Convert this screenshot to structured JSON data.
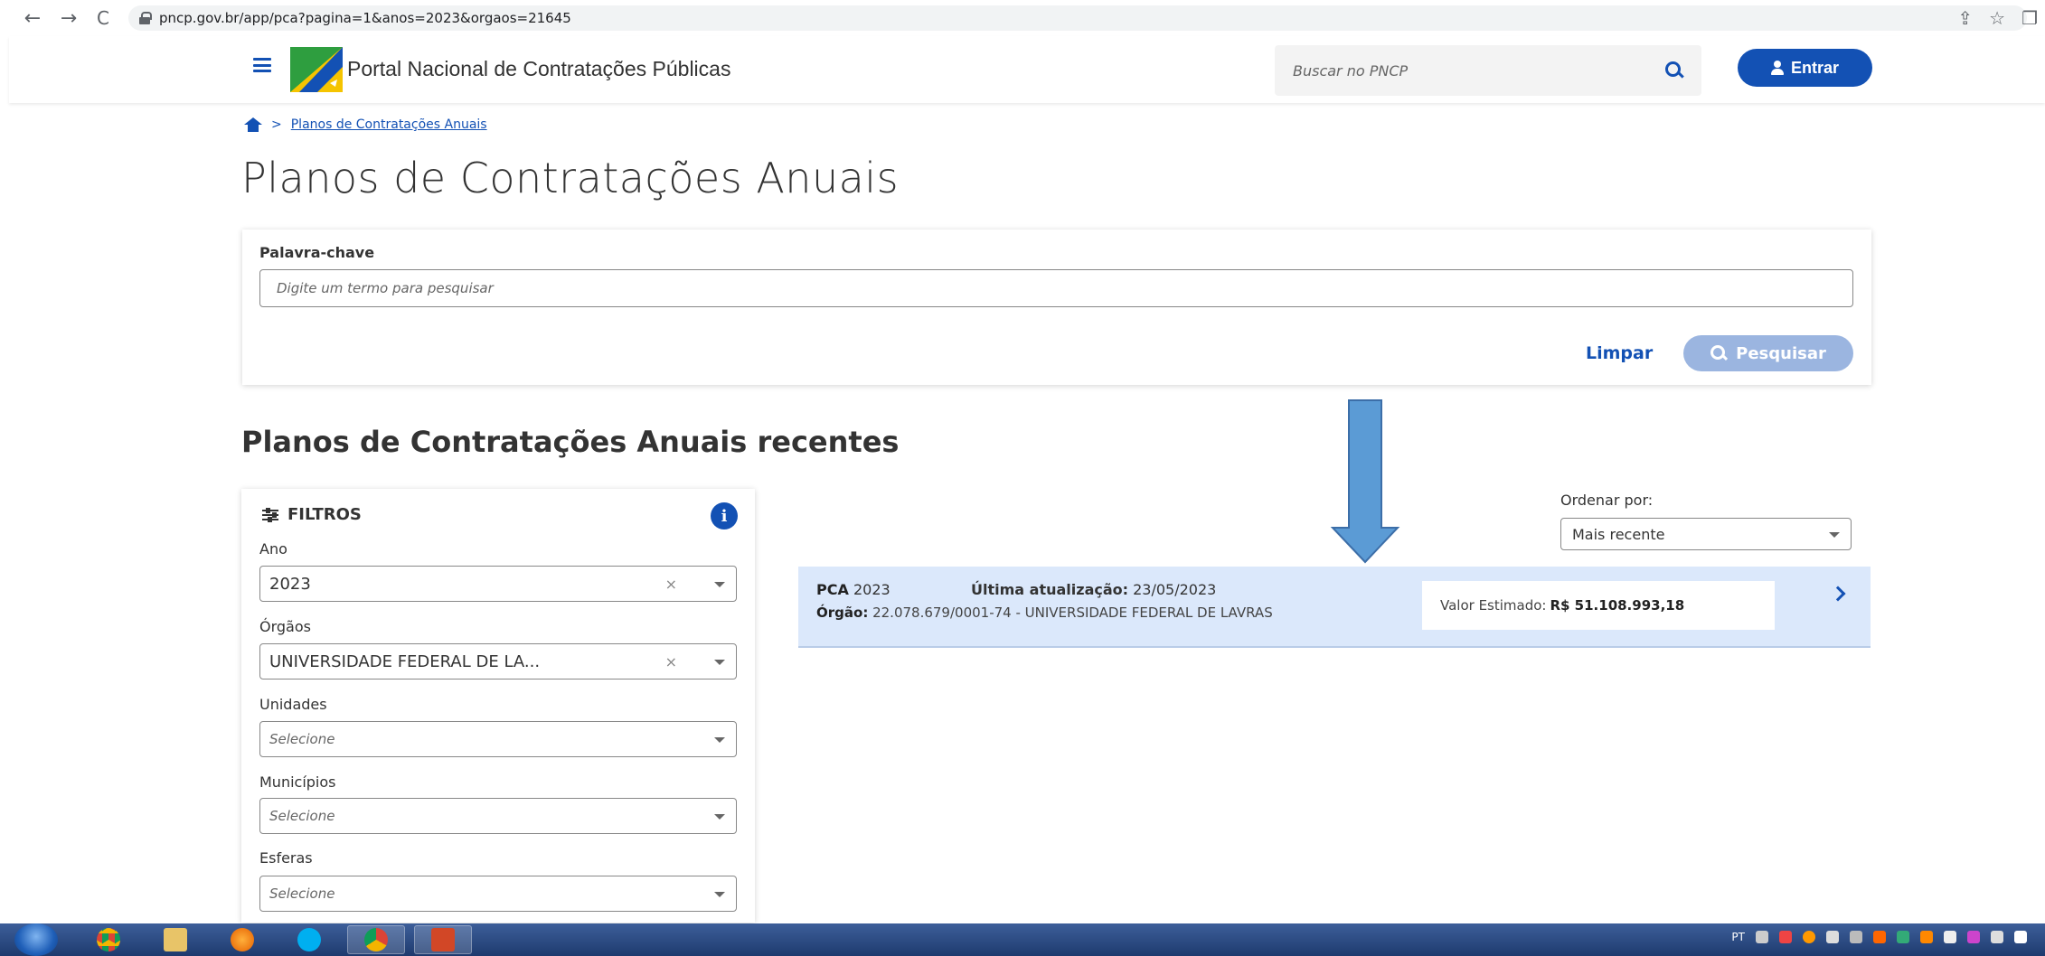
{
  "browser": {
    "url": "pncp.gov.br/app/pca?pagina=1&anos=2023&orgaos=21645",
    "back": "←",
    "forward": "→",
    "reload": "C",
    "share": "⇪",
    "star": "☆",
    "window": "❐"
  },
  "header": {
    "title": "Portal Nacional de Contratações Públicas",
    "search_placeholder": "Buscar no PNCP",
    "login_label": "Entrar"
  },
  "breadcrumb": {
    "separator": ">",
    "current": "Planos de Contratações Anuais"
  },
  "page_title": "Planos de Contratações Anuais",
  "keyword": {
    "label": "Palavra-chave",
    "placeholder": "Digite um termo para pesquisar",
    "clear_label": "Limpar",
    "search_label": "Pesquisar"
  },
  "section_title": "Planos de Contratações Anuais recentes",
  "filters": {
    "title": "FILTROS",
    "info": "i",
    "clear_symbol": "×",
    "fields": [
      {
        "label": "Ano",
        "value": "2023"
      },
      {
        "label": "Órgãos",
        "value": "UNIVERSIDADE FEDERAL DE LA..."
      },
      {
        "label": "Unidades",
        "value": "Selecione"
      },
      {
        "label": "Municípios",
        "value": "Selecione"
      },
      {
        "label": "Esferas",
        "value": "Selecione"
      }
    ]
  },
  "sort": {
    "label": "Ordenar por:",
    "value": "Mais recente"
  },
  "result": {
    "pca_label": "PCA",
    "pca_year": "2023",
    "updated_label": "Última atualização:",
    "updated_value": "23/05/2023",
    "org_label": "Órgão:",
    "org_value": "22.078.679/0001-74 - UNIVERSIDADE FEDERAL DE LAVRAS",
    "value_label": "Valor Estimado:",
    "value_amount": "R$ 51.108.993,18"
  },
  "taskbar": {
    "tray_lang": "PT"
  },
  "colors": {
    "primary": "#1351b4",
    "result_bg": "#dbe8fb",
    "arrow": "#5b9bd5"
  }
}
